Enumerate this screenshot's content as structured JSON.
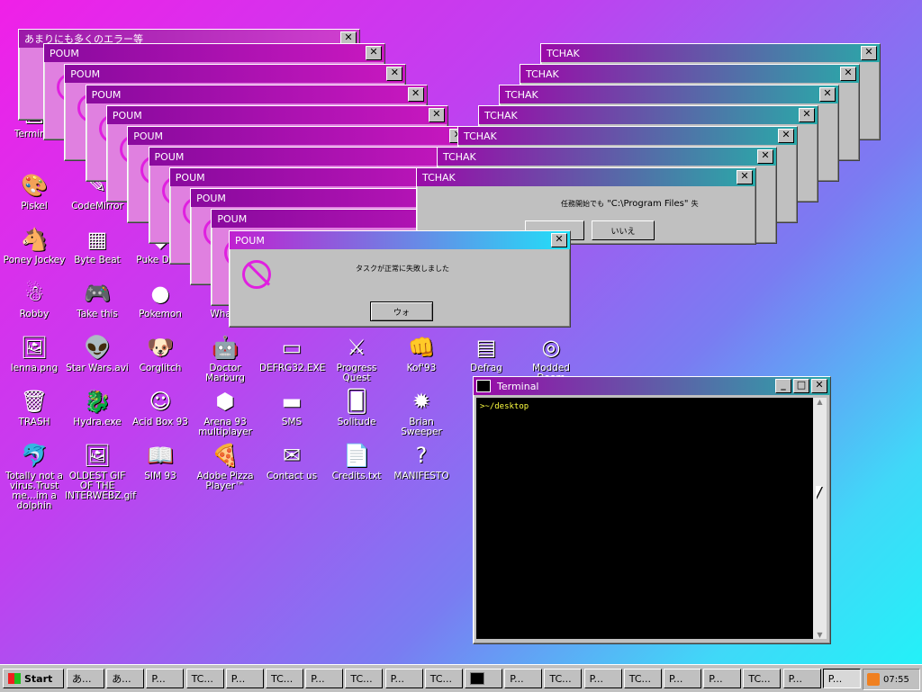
{
  "desktop_icons": [
    {
      "id": "terminal",
      "label": "Terminal",
      "glyph": "▣"
    },
    {
      "id": "piskel",
      "label": "Piskel",
      "glyph": "🎨"
    },
    {
      "id": "codemirror",
      "label": "CodeMirror",
      "glyph": "✎"
    },
    {
      "id": "poney",
      "label": "Poney Jockey",
      "glyph": "🐴"
    },
    {
      "id": "bytebeat",
      "label": "Byte Beat",
      "glyph": "▦"
    },
    {
      "id": "puke",
      "label": "Puke Data",
      "glyph": "◆"
    },
    {
      "id": "robby",
      "label": "Robby",
      "glyph": "☃"
    },
    {
      "id": "takethis",
      "label": "Take this",
      "glyph": "🎮"
    },
    {
      "id": "pokemon",
      "label": "Pokemon",
      "glyph": "●"
    },
    {
      "id": "what",
      "label": "What?",
      "glyph": "?"
    },
    {
      "id": "lenna",
      "label": "lenna.png",
      "glyph": "🖼"
    },
    {
      "id": "starwars",
      "label": "Star Wars.avi",
      "glyph": "👽"
    },
    {
      "id": "corglitch",
      "label": "Corglitch",
      "glyph": "🐶"
    },
    {
      "id": "docmarburg",
      "label": "Doctor Marburg",
      "glyph": "🤖"
    },
    {
      "id": "defrag32",
      "label": "DEFRG32.EXE",
      "glyph": "▭"
    },
    {
      "id": "progquest",
      "label": "Progress Quest",
      "glyph": "⚔"
    },
    {
      "id": "kof93",
      "label": "Kof'93",
      "glyph": "👊"
    },
    {
      "id": "defrag",
      "label": "Defrag",
      "glyph": "▤"
    },
    {
      "id": "modded",
      "label": "Modded Doom",
      "glyph": "◎"
    },
    {
      "id": "trash",
      "label": "TRASH",
      "glyph": "🗑"
    },
    {
      "id": "hydra",
      "label": "Hydra.exe",
      "glyph": "🐉"
    },
    {
      "id": "acidbox",
      "label": "Acid Box 93",
      "glyph": "☺"
    },
    {
      "id": "arena",
      "label": "Arena 93 multiplayer",
      "glyph": "⬢"
    },
    {
      "id": "sms",
      "label": "SMS",
      "glyph": "▬"
    },
    {
      "id": "solitude",
      "label": "Solitude",
      "glyph": "🂠"
    },
    {
      "id": "brian",
      "label": "Brian Sweeper",
      "glyph": "✹"
    },
    {
      "id": "dolphin",
      "label": "Totally not a virus.Trust me...im a dolphin",
      "glyph": "🐬"
    },
    {
      "id": "oldestgif",
      "label": "OLDEST GIF OF THE INTERWEBZ.gif",
      "glyph": "🖼"
    },
    {
      "id": "sim93",
      "label": "SIM 93",
      "glyph": "📖"
    },
    {
      "id": "pizza",
      "label": "Adobe Pizza Player™",
      "glyph": "🍕"
    },
    {
      "id": "contact",
      "label": "Contact us",
      "glyph": "✉"
    },
    {
      "id": "credits",
      "label": "Credits.txt",
      "glyph": "📄"
    },
    {
      "id": "manifesto",
      "label": "MANIFESTO",
      "glyph": "?"
    }
  ],
  "error_window_back": {
    "title": "あまりにも多くのエラー等"
  },
  "poum_title": "POUM",
  "tchak_title": "TCHAK",
  "front_poum": {
    "message": "タスクが正常に失敗しました",
    "button": "ウォ"
  },
  "front_tchak": {
    "message_prefix": "任務開始でも",
    "path": "\"C:\\Program Files\"",
    "message_suffix": "失",
    "button_no": "いいえ"
  },
  "terminal": {
    "title": "Terminal",
    "prompt": ">~/desktop"
  },
  "taskbar": {
    "start": "Start",
    "items": [
      "あ...",
      "あ...",
      "P...",
      "TC...",
      "P...",
      "TC...",
      "P...",
      "TC...",
      "P...",
      "TC...",
      "",
      "P...",
      "TC...",
      "P...",
      "TC...",
      "P...",
      "P...",
      "TC...",
      "P...",
      "P..."
    ],
    "clock": "07:55"
  },
  "colors": {
    "poum_accent": "#e020e0",
    "terminal_text": "#ffff40"
  }
}
